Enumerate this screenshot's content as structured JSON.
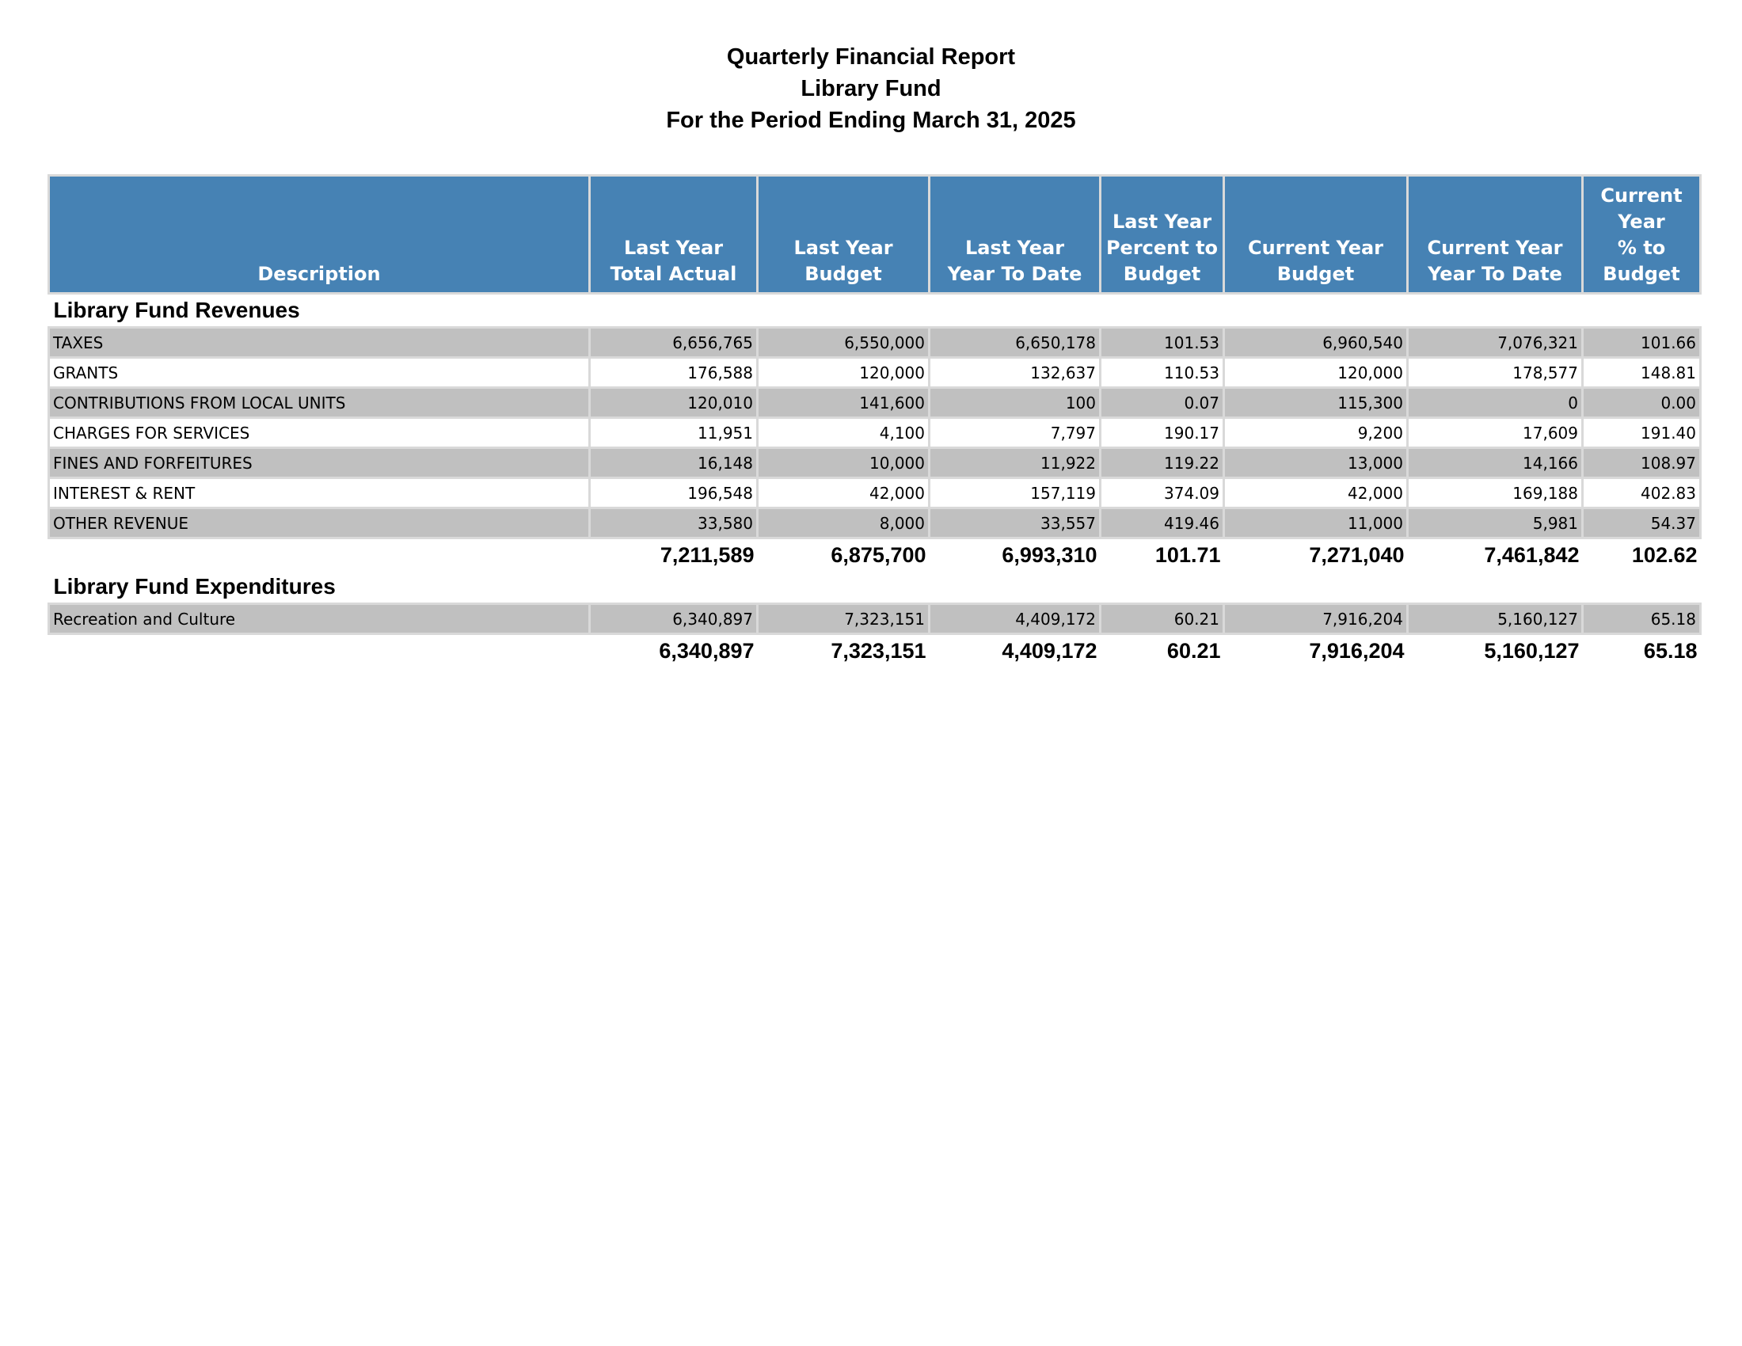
{
  "report": {
    "title_lines": [
      "Quarterly Financial Report",
      "Library Fund",
      "For the Period Ending March 31, 2025"
    ]
  },
  "table": {
    "columns": [
      "Description",
      "Last Year\nTotal Actual",
      "Last Year\nBudget",
      "Last Year\nYear To Date",
      "Last Year\nPercent to\nBudget",
      "Current Year\nBudget",
      "Current Year\nYear To Date",
      "Current\nYear\n% to\nBudget"
    ],
    "sections": [
      {
        "heading": "Library Fund Revenues",
        "rows": [
          [
            "TAXES",
            "6,656,765",
            "6,550,000",
            "6,650,178",
            "101.53",
            "6,960,540",
            "7,076,321",
            "101.66"
          ],
          [
            "GRANTS",
            "176,588",
            "120,000",
            "132,637",
            "110.53",
            "120,000",
            "178,577",
            "148.81"
          ],
          [
            "CONTRIBUTIONS FROM LOCAL UNITS",
            "120,010",
            "141,600",
            "100",
            "0.07",
            "115,300",
            "0",
            "0.00"
          ],
          [
            "CHARGES FOR SERVICES",
            "11,951",
            "4,100",
            "7,797",
            "190.17",
            "9,200",
            "17,609",
            "191.40"
          ],
          [
            "FINES AND FORFEITURES",
            "16,148",
            "10,000",
            "11,922",
            "119.22",
            "13,000",
            "14,166",
            "108.97"
          ],
          [
            "INTEREST & RENT",
            "196,548",
            "42,000",
            "157,119",
            "374.09",
            "42,000",
            "169,188",
            "402.83"
          ],
          [
            "OTHER REVENUE",
            "33,580",
            "8,000",
            "33,557",
            "419.46",
            "11,000",
            "5,981",
            "54.37"
          ]
        ],
        "total": [
          "7,211,589",
          "6,875,700",
          "6,993,310",
          "101.71",
          "7,271,040",
          "7,461,842",
          "102.62"
        ]
      },
      {
        "heading": "Library Fund Expenditures",
        "rows": [
          [
            "Recreation and Culture",
            "6,340,897",
            "7,323,151",
            "4,409,172",
            "60.21",
            "7,916,204",
            "5,160,127",
            "65.18"
          ]
        ],
        "total": [
          "6,340,897",
          "7,323,151",
          "4,409,172",
          "60.21",
          "7,916,204",
          "5,160,127",
          "65.18"
        ]
      }
    ]
  },
  "colors": {
    "header_bg": "#4682b4",
    "shaded_row": "#c0c0c0",
    "grid_line": "#d9d9d9"
  }
}
